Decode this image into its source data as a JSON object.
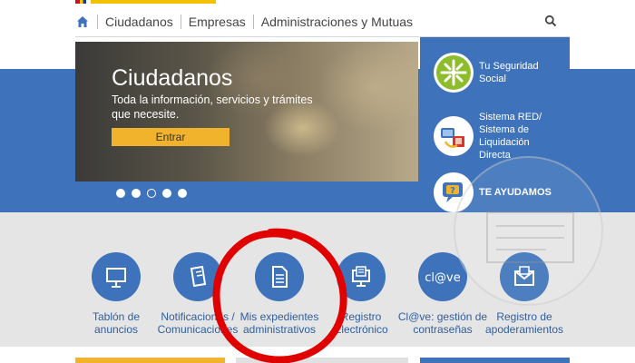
{
  "nav": {
    "items": [
      "Ciudadanos",
      "Empresas",
      "Administraciones y Mutuas"
    ]
  },
  "hero": {
    "title": "Ciudadanos",
    "subtitle": "Toda la información, servicios y trámites que necesite.",
    "button": "Entrar",
    "slides": 5,
    "active_slide": 3
  },
  "side_links": [
    {
      "label": "Tu Seguridad Social",
      "icon": "seguridad-social-logo-icon"
    },
    {
      "label": "Sistema RED/ Sistema de Liquidación Directa",
      "icon": "sistema-red-icon"
    },
    {
      "label": "TE AYUDAMOS",
      "icon": "help-chat-icon"
    }
  ],
  "services": [
    {
      "label": "Tablón de anuncios",
      "icon": "noticeboard-icon"
    },
    {
      "label": "Notificaciones / Comunicaciones",
      "icon": "notifications-icon"
    },
    {
      "label": "Mis expedientes administrativos",
      "icon": "document-icon"
    },
    {
      "label": "Registro Electrónico",
      "icon": "electronic-register-icon"
    },
    {
      "label": "Cl@ve: gestión de contraseñas",
      "icon": "clave-icon"
    },
    {
      "label": "Registro de apoderamientos",
      "icon": "envelope-icon"
    }
  ],
  "colors": {
    "primary_blue": "#3e73bb",
    "accent_yellow": "#f0b32b",
    "annotation_red": "#e00000"
  }
}
